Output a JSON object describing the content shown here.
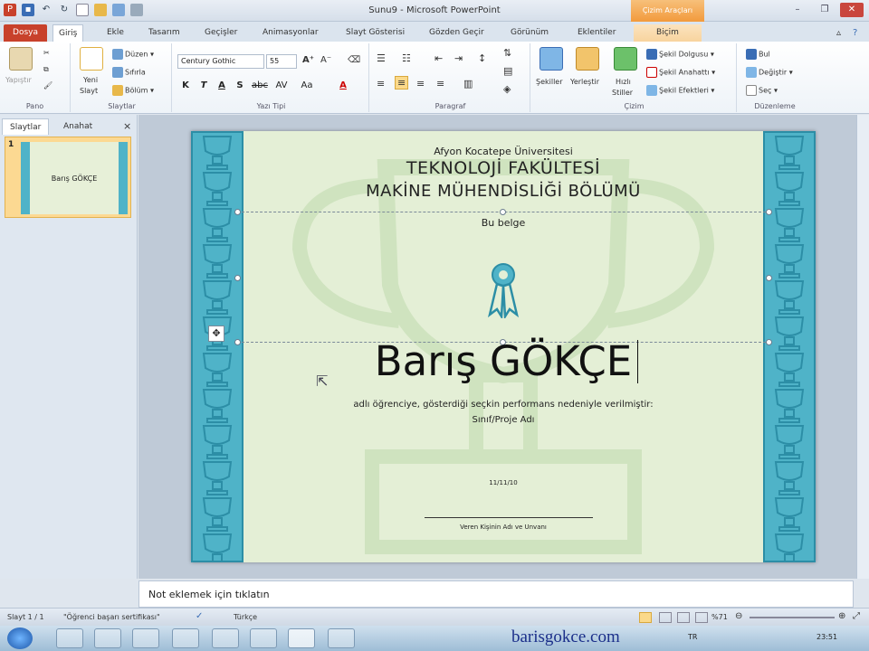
{
  "window": {
    "title": "Sunu9 - Microsoft PowerPoint",
    "contextual_tab_header": "Çizim Araçları"
  },
  "tabs": [
    {
      "label": "Dosya"
    },
    {
      "label": "Giriş"
    },
    {
      "label": "Ekle"
    },
    {
      "label": "Tasarım"
    },
    {
      "label": "Geçişler"
    },
    {
      "label": "Animasyonlar"
    },
    {
      "label": "Slayt Gösterisi"
    },
    {
      "label": "Gözden Geçir"
    },
    {
      "label": "Görünüm"
    },
    {
      "label": "Eklentiler"
    },
    {
      "label": "Biçim"
    }
  ],
  "ribbon": {
    "pano": {
      "label": "Pano",
      "paste": "Yapıştır"
    },
    "slaytlar": {
      "label": "Slaytlar",
      "new_slide_1": "Yeni",
      "new_slide_2": "Slayt",
      "layout": "Düzen",
      "reset": "Sıfırla",
      "section": "Bölüm"
    },
    "yazi_tipi": {
      "label": "Yazı Tipi",
      "font": "Century Gothic",
      "size": "55"
    },
    "paragraf": {
      "label": "Paragraf"
    },
    "cizim": {
      "label": "Çizim",
      "shapes": "Şekiller",
      "arrange": "Yerleştir",
      "quick_styles_1": "Hızlı",
      "quick_styles_2": "Stiller",
      "fill": "Şekil Dolgusu",
      "outline": "Şekil Anahattı",
      "effects": "Şekil Efektleri"
    },
    "duzenleme": {
      "label": "Düzenleme",
      "find": "Bul",
      "replace": "Değiştir",
      "select": "Seç"
    }
  },
  "left_pane": {
    "tab_slides": "Slaytlar",
    "tab_outline": "Anahat",
    "close": "×",
    "slide_number": "1",
    "thumb_name": "Barış GÖKÇE"
  },
  "slide": {
    "university": "Afyon Kocatepe Üniversitesi",
    "faculty": "TEKNOLOJİ FAKÜLTESİ",
    "department": "MAKİNE MÜHENDİSLİĞİ BÖLÜMÜ",
    "intro": "Bu belge",
    "name": "Barış GÖKÇE",
    "body": "adlı öğrenciye, gösterdiği seçkin performans nedeniyle verilmiştir:",
    "class_project": "Sınıf/Proje Adı",
    "date": "11/11/10",
    "signer": "Veren Kişinin Adı ve Unvanı"
  },
  "notes": {
    "placeholder": "Not eklemek için tıklatın"
  },
  "status": {
    "slide_counter": "Slayt 1 / 1",
    "theme": "\"Öğrenci başarı sertifikası\"",
    "language": "Türkçe",
    "zoom": "%71"
  },
  "taskbar": {
    "lang": "TR",
    "clock": "23:51"
  },
  "watermark": "barisgokce.com",
  "colors": {
    "accent_file": "#c8412b",
    "border_teal": "#4fb3c8",
    "slide_bg": "#e4efd6",
    "contextual": "#f29a3c"
  }
}
